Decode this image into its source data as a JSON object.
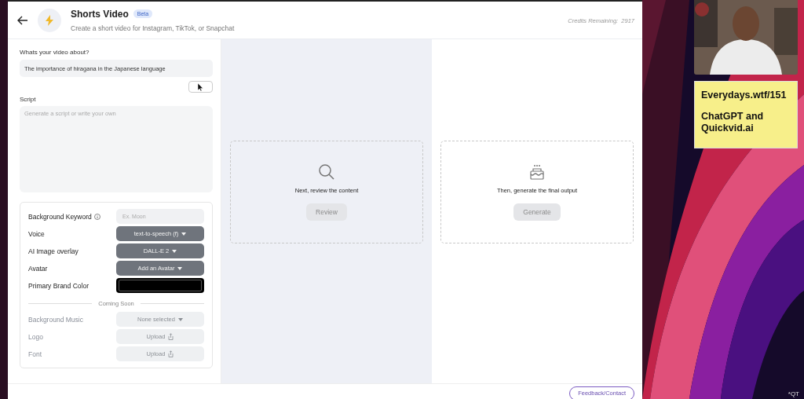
{
  "header": {
    "title": "Shorts Video",
    "badge": "Beta",
    "subtitle": "Create a short video for Instagram, TikTok, or Snapchat",
    "credits_label": "Credits Remaining:",
    "credits_value": "2917"
  },
  "topic": {
    "label": "Whats your video about?",
    "value": "The importance of hiragana in the Japanese language"
  },
  "script": {
    "label": "Script",
    "placeholder": "Generate a script or write your own"
  },
  "settings": [
    {
      "label": "Background Keyword",
      "kind": "input",
      "placeholder": "Ex. Moon",
      "info": true,
      "disabled": false
    },
    {
      "label": "Voice",
      "kind": "dropdown",
      "value": "text-to-speech (f)",
      "info": false,
      "disabled": false
    },
    {
      "label": "AI Image overlay",
      "kind": "dropdown",
      "value": "DALL-E 2",
      "info": false,
      "disabled": false
    },
    {
      "label": "Avatar",
      "kind": "dropdown",
      "value": "Add an Avatar",
      "info": false,
      "disabled": false
    },
    {
      "label": "Primary Brand Color",
      "kind": "color",
      "color": "#000000",
      "info": false,
      "disabled": false
    }
  ],
  "coming_soon": {
    "label": "Coming Soon",
    "items": [
      {
        "label": "Background Music",
        "kind": "dropdown",
        "value": "None selected",
        "info": false,
        "disabled": true
      },
      {
        "label": "Logo",
        "kind": "upload",
        "value": "Upload",
        "info": false,
        "disabled": true
      },
      {
        "label": "Font",
        "kind": "upload",
        "value": "Upload",
        "info": false,
        "disabled": true
      }
    ]
  },
  "steps": [
    {
      "kind": "search",
      "text": "Next, review the content",
      "button": "Review",
      "shaded": true
    },
    {
      "kind": "cake",
      "text": "Then, generate the final output",
      "button": "Generate",
      "shaded": false
    }
  ],
  "footer": {
    "button": "Feedback/Contact"
  },
  "overlay": {
    "note": [
      "Everydays.wtf/151",
      "ChatGPT and Quickvid.ai"
    ],
    "corner_mark": "*QT"
  }
}
